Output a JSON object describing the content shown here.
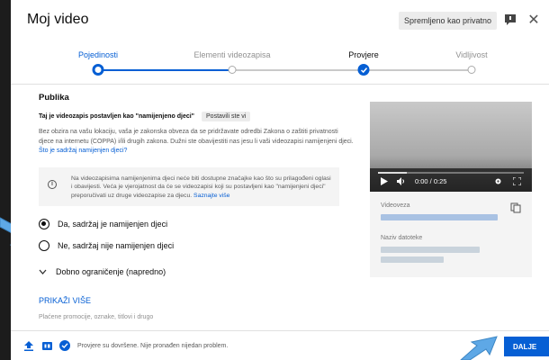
{
  "dialog": {
    "title": "Moj video",
    "save_status": "Spremljeno kao privatno",
    "close_glyph": "✕"
  },
  "stepper": {
    "steps": [
      {
        "label": "Pojedinosti",
        "state": "current"
      },
      {
        "label": "Elementi videozapisa",
        "state": "pending"
      },
      {
        "label": "Provjere",
        "state": "done"
      },
      {
        "label": "Vidljivost",
        "state": "pending"
      }
    ]
  },
  "audience": {
    "heading": "Publika",
    "kids_status": "Taj je videozapis postavljen kao \"namijenjeno djeci\"",
    "kids_chip": "Postavili ste vi",
    "paragraph": "Bez obzira na vašu lokaciju, vaša je zakonska obveza da se pridržavate odredbi Zakona o zaštiti privatnosti djece na internetu (COPPA) i/ili drugih zakona. Dužni ste obavijestiti nas jesu li vaši videozapisi namijenjeni djeci.",
    "paragraph_link": "Što je sadržaj namijenjen djeci?",
    "info_text": "Na videozapisima namijenjenima djeci neće biti dostupne značajke kao što su prilagođeni oglasi i obavijesti. Veća je vjerojatnost da će se videozapisi koji su postavljeni kao \"namijenjeni djeci\" preporučivati uz druge videozapise za djecu.",
    "info_link": "Saznajte više",
    "option_yes": "Da, sadržaj je namijenjen djeci",
    "option_no": "Ne, sadržaj nije namijenjen djeci",
    "selected": "yes",
    "age_restriction": "Dobno ograničenje (napredno)",
    "show_more": "PRIKAŽI VIŠE",
    "show_more_desc": "Plaćene promocije, oznake, titlovi i drugo"
  },
  "preview": {
    "time": "0:00 / 0:25",
    "progress": 0.2,
    "link_label": "Videoveza",
    "filename_label": "Naziv datoteke"
  },
  "footer": {
    "status": "Provjere su dovršene. Nije pronađen nijedan problem.",
    "next_label": "DALJE"
  },
  "colors": {
    "accent": "#065fd4",
    "callout_arrow": "#5ea8e6"
  }
}
